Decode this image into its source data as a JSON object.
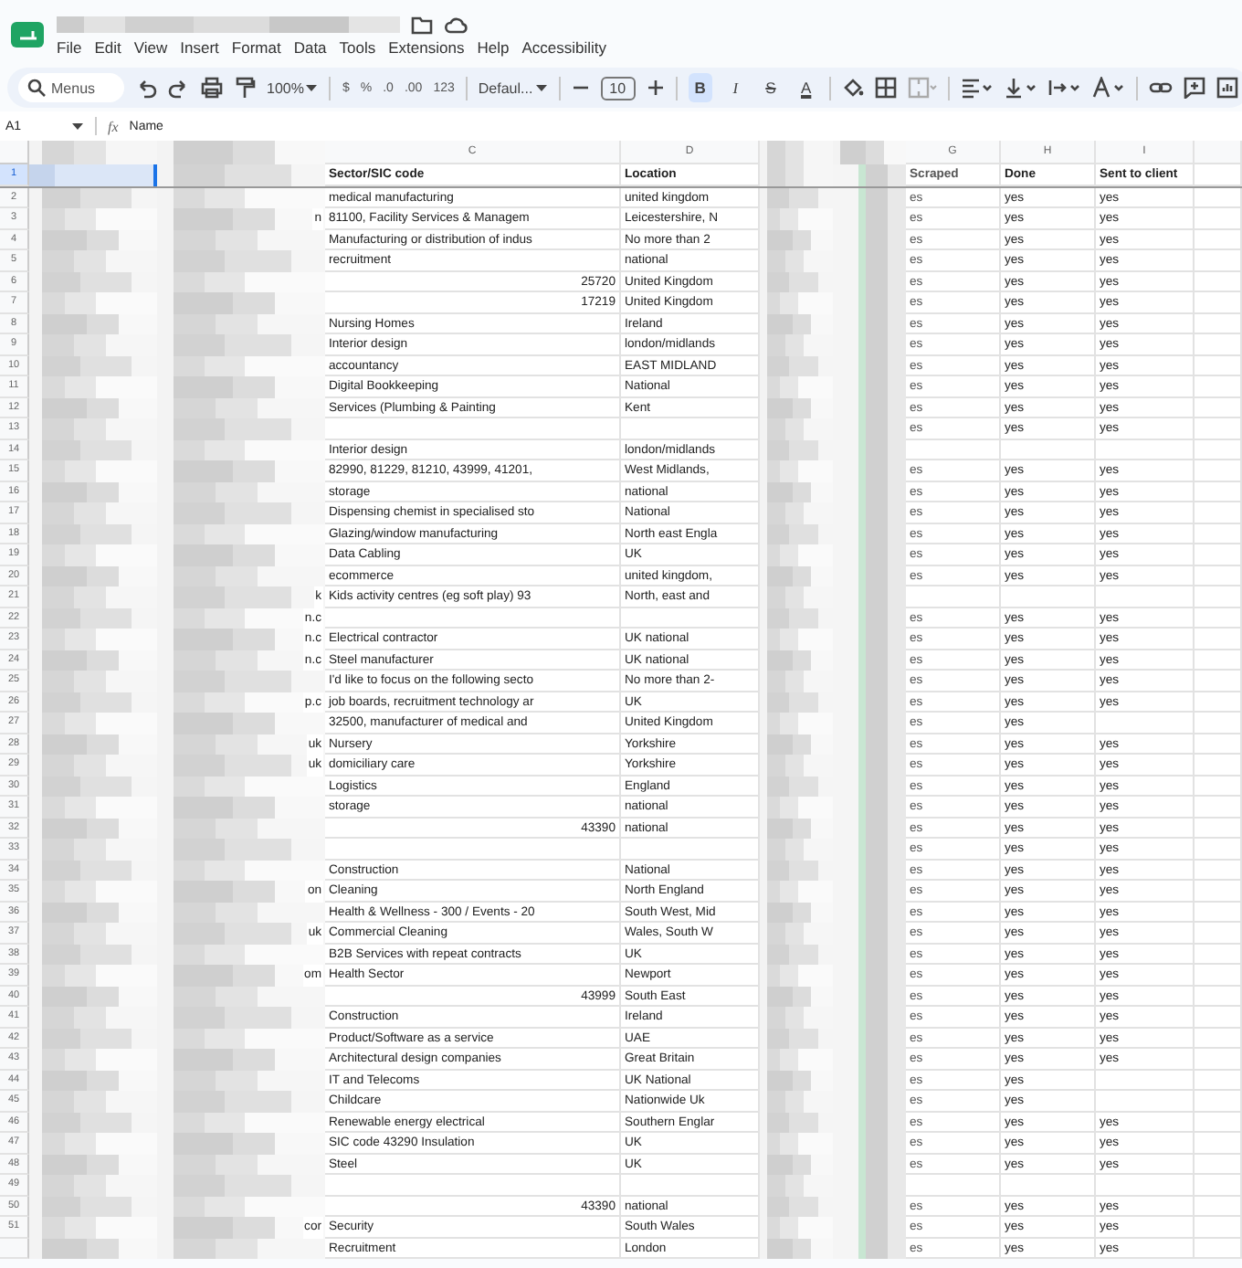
{
  "menu": [
    "File",
    "Edit",
    "View",
    "Insert",
    "Format",
    "Data",
    "Tools",
    "Extensions",
    "Help",
    "Accessibility"
  ],
  "toolbar": {
    "search_placeholder": "Menus",
    "zoom": "100%",
    "number_formats": [
      "$",
      "%",
      ".0",
      ".00",
      "123"
    ],
    "font": "Defaul...",
    "font_size": "10",
    "styles": [
      {
        "label": "B",
        "kind": "bold",
        "selected": true
      },
      {
        "label": "I",
        "kind": "italic",
        "selected": false
      },
      {
        "label": "S",
        "kind": "strike",
        "selected": false
      },
      {
        "label": "A",
        "kind": "color",
        "selected": false
      }
    ]
  },
  "formula_bar": {
    "cell_ref": "A1",
    "fx": "fx",
    "formula": "Name"
  },
  "columns": [
    {
      "kind": "blurred"
    },
    {
      "kind": "blurred"
    },
    {
      "kind": "label",
      "letter": "C"
    },
    {
      "kind": "label",
      "letter": "D"
    },
    {
      "kind": "blurred"
    },
    {
      "kind": "blurred"
    },
    {
      "kind": "label",
      "letter": "G"
    },
    {
      "kind": "label",
      "letter": "H"
    },
    {
      "kind": "label",
      "letter": "I"
    }
  ],
  "rows": [
    {
      "number": "1",
      "selected": true,
      "kind": "header",
      "c": {
        "text": "Sector/SIC code",
        "kind": "text"
      },
      "d": "Location",
      "g": "Scraped",
      "h": "Done",
      "i": "Sent to client"
    },
    {
      "number": "2",
      "selected": false,
      "kind": "data",
      "c": {
        "text": "medical manufacturing",
        "kind": "text"
      },
      "d": "united kingdom",
      "g": "es",
      "h": "yes",
      "i": "yes"
    },
    {
      "number": "3",
      "selected": false,
      "kind": "data",
      "b_tail": "n",
      "c": {
        "text": "81100, Facility Services & Managem",
        "kind": "text"
      },
      "d": "Leicestershire, N",
      "g": "es",
      "h": "yes",
      "i": "yes"
    },
    {
      "number": "4",
      "selected": false,
      "kind": "data",
      "c": {
        "text": "Manufacturing or distribution of indus",
        "kind": "text"
      },
      "d": "No more than 2",
      "g": "es",
      "h": "yes",
      "i": "yes"
    },
    {
      "number": "5",
      "selected": false,
      "kind": "data",
      "c": {
        "text": "recruitment",
        "kind": "text"
      },
      "d": "national",
      "g": "es",
      "h": "yes",
      "i": "yes"
    },
    {
      "number": "6",
      "selected": false,
      "kind": "data",
      "c": {
        "text": "25720",
        "kind": "number"
      },
      "d": "United Kingdom",
      "g": "es",
      "h": "yes",
      "i": "yes"
    },
    {
      "number": "7",
      "selected": false,
      "kind": "data",
      "c": {
        "text": "17219",
        "kind": "number"
      },
      "d": "United Kingdom",
      "g": "es",
      "h": "yes",
      "i": "yes"
    },
    {
      "number": "8",
      "selected": false,
      "kind": "data",
      "c": {
        "text": "Nursing Homes",
        "kind": "text"
      },
      "d": "Ireland",
      "g": "es",
      "h": "yes",
      "i": "yes"
    },
    {
      "number": "9",
      "selected": false,
      "kind": "data",
      "c": {
        "text": "Interior design",
        "kind": "text"
      },
      "d": "london/midlands",
      "g": "es",
      "h": "yes",
      "i": "yes"
    },
    {
      "number": "10",
      "selected": false,
      "kind": "data",
      "c": {
        "text": "accountancy",
        "kind": "text"
      },
      "d": "EAST MIDLAND",
      "g": "es",
      "h": "yes",
      "i": "yes"
    },
    {
      "number": "11",
      "selected": false,
      "kind": "data",
      "c": {
        "text": "Digital Bookkeeping",
        "kind": "text"
      },
      "d": "National",
      "g": "es",
      "h": "yes",
      "i": "yes"
    },
    {
      "number": "12",
      "selected": false,
      "kind": "data",
      "c": {
        "text": "Services (Plumbing & Painting",
        "kind": "text"
      },
      "d": "Kent",
      "g": "es",
      "h": "yes",
      "i": "yes"
    },
    {
      "number": "13",
      "selected": false,
      "kind": "data",
      "g": "es",
      "h": "yes",
      "i": "yes"
    },
    {
      "number": "14",
      "selected": false,
      "kind": "data",
      "c": {
        "text": "Interior design",
        "kind": "text"
      },
      "d": "london/midlands"
    },
    {
      "number": "15",
      "selected": false,
      "kind": "data",
      "c": {
        "text": "82990, 81229, 81210, 43999, 41201,",
        "kind": "text"
      },
      "d": "West Midlands,",
      "g": "es",
      "h": "yes",
      "i": "yes"
    },
    {
      "number": "16",
      "selected": false,
      "kind": "data",
      "c": {
        "text": "storage",
        "kind": "text"
      },
      "d": "national",
      "g": "es",
      "h": "yes",
      "i": "yes"
    },
    {
      "number": "17",
      "selected": false,
      "kind": "data",
      "c": {
        "text": "Dispensing chemist in specialised sto",
        "kind": "text"
      },
      "d": "National",
      "g": "es",
      "h": "yes",
      "i": "yes"
    },
    {
      "number": "18",
      "selected": false,
      "kind": "data",
      "c": {
        "text": "Glazing/window manufacturing",
        "kind": "text"
      },
      "d": "North east Engla",
      "g": "es",
      "h": "yes",
      "i": "yes"
    },
    {
      "number": "19",
      "selected": false,
      "kind": "data",
      "c": {
        "text": "Data Cabling",
        "kind": "text"
      },
      "d": "UK",
      "g": "es",
      "h": "yes",
      "i": "yes"
    },
    {
      "number": "20",
      "selected": false,
      "kind": "data",
      "c": {
        "text": "ecommerce",
        "kind": "text"
      },
      "d": "united kingdom,",
      "g": "es",
      "h": "yes",
      "i": "yes"
    },
    {
      "number": "21",
      "selected": false,
      "kind": "data",
      "b_tail": "k",
      "c": {
        "text": "Kids activity centres (eg soft play) 93",
        "kind": "text"
      },
      "d": "North, east and"
    },
    {
      "number": "22",
      "selected": false,
      "kind": "data",
      "b_tail": "n.c",
      "g": "es",
      "h": "yes",
      "i": "yes"
    },
    {
      "number": "23",
      "selected": false,
      "kind": "data",
      "b_tail": "n.c",
      "c": {
        "text": "Electrical contractor",
        "kind": "text"
      },
      "d": "UK national",
      "g": "es",
      "h": "yes",
      "i": "yes"
    },
    {
      "number": "24",
      "selected": false,
      "kind": "data",
      "b_tail": "n.c",
      "c": {
        "text": "Steel manufacturer",
        "kind": "text"
      },
      "d": "UK national",
      "g": "es",
      "h": "yes",
      "i": "yes"
    },
    {
      "number": "25",
      "selected": false,
      "kind": "data",
      "c": {
        "text": "I'd like to focus on the following secto",
        "kind": "text"
      },
      "d": "No more than 2-",
      "g": "es",
      "h": "yes",
      "i": "yes"
    },
    {
      "number": "26",
      "selected": false,
      "kind": "data",
      "b_tail": "p.c",
      "c": {
        "text": "job boards, recruitment technology ar",
        "kind": "text"
      },
      "d": "UK",
      "g": "es",
      "h": "yes",
      "i": "yes"
    },
    {
      "number": "27",
      "selected": false,
      "kind": "data",
      "c": {
        "text": "32500, manufacturer of medical and",
        "kind": "text"
      },
      "d": "United Kingdom",
      "g": "es",
      "h": "yes"
    },
    {
      "number": "28",
      "selected": false,
      "kind": "data",
      "b_tail": "uk",
      "c": {
        "text": "Nursery",
        "kind": "text"
      },
      "d": "Yorkshire",
      "g": "es",
      "h": "yes",
      "i": "yes"
    },
    {
      "number": "29",
      "selected": false,
      "kind": "data",
      "b_tail": "uk",
      "c": {
        "text": "domiciliary care",
        "kind": "text"
      },
      "d": "Yorkshire",
      "g": "es",
      "h": "yes",
      "i": "yes"
    },
    {
      "number": "30",
      "selected": false,
      "kind": "data",
      "c": {
        "text": "Logistics",
        "kind": "text"
      },
      "d": "England",
      "g": "es",
      "h": "yes",
      "i": "yes"
    },
    {
      "number": "31",
      "selected": false,
      "kind": "data",
      "c": {
        "text": "storage",
        "kind": "text"
      },
      "d": "national",
      "g": "es",
      "h": "yes",
      "i": "yes"
    },
    {
      "number": "32",
      "selected": false,
      "kind": "data",
      "c": {
        "text": "43390",
        "kind": "number"
      },
      "d": "national",
      "g": "es",
      "h": "yes",
      "i": "yes"
    },
    {
      "number": "33",
      "selected": false,
      "kind": "data",
      "g": "es",
      "h": "yes",
      "i": "yes"
    },
    {
      "number": "34",
      "selected": false,
      "kind": "data",
      "c": {
        "text": "Construction",
        "kind": "text"
      },
      "d": "National",
      "g": "es",
      "h": "yes",
      "i": "yes"
    },
    {
      "number": "35",
      "selected": false,
      "kind": "data",
      "b_tail": "on",
      "c": {
        "text": "Cleaning",
        "kind": "text"
      },
      "d": "North England",
      "g": "es",
      "h": "yes",
      "i": "yes"
    },
    {
      "number": "36",
      "selected": false,
      "kind": "data",
      "c": {
        "text": "Health & Wellness - 300 / Events - 20",
        "kind": "text"
      },
      "d": "South West, Mid",
      "g": "es",
      "h": "yes",
      "i": "yes"
    },
    {
      "number": "37",
      "selected": false,
      "kind": "data",
      "b_tail": "uk",
      "c": {
        "text": "Commercial Cleaning",
        "kind": "text"
      },
      "d": "Wales, South W",
      "g": "es",
      "h": "yes",
      "i": "yes"
    },
    {
      "number": "38",
      "selected": false,
      "kind": "data",
      "c": {
        "text": "B2B Services with repeat contracts",
        "kind": "text"
      },
      "d": "UK",
      "g": "es",
      "h": "yes",
      "i": "yes"
    },
    {
      "number": "39",
      "selected": false,
      "kind": "data",
      "b_tail": "om",
      "c": {
        "text": "Health Sector",
        "kind": "text"
      },
      "d": "Newport",
      "g": "es",
      "h": "yes",
      "i": "yes"
    },
    {
      "number": "40",
      "selected": false,
      "kind": "data",
      "c": {
        "text": "43999",
        "kind": "number"
      },
      "d": "South East",
      "g": "es",
      "h": "yes",
      "i": "yes"
    },
    {
      "number": "41",
      "selected": false,
      "kind": "data",
      "c": {
        "text": "Construction",
        "kind": "text"
      },
      "d": "Ireland",
      "g": "es",
      "h": "yes",
      "i": "yes"
    },
    {
      "number": "42",
      "selected": false,
      "kind": "data",
      "c": {
        "text": "Product/Software as a service",
        "kind": "text"
      },
      "d": "UAE",
      "g": "es",
      "h": "yes",
      "i": "yes"
    },
    {
      "number": "43",
      "selected": false,
      "kind": "data",
      "c": {
        "text": "Architectural design companies",
        "kind": "text"
      },
      "d": "Great Britain",
      "g": "es",
      "h": "yes",
      "i": "yes"
    },
    {
      "number": "44",
      "selected": false,
      "kind": "data",
      "c": {
        "text": "IT and Telecoms",
        "kind": "text"
      },
      "d": "UK National",
      "g": "es",
      "h": "yes"
    },
    {
      "number": "45",
      "selected": false,
      "kind": "data",
      "c": {
        "text": "Childcare",
        "kind": "text"
      },
      "d": "Nationwide Uk",
      "g": "es",
      "h": "yes"
    },
    {
      "number": "46",
      "selected": false,
      "kind": "data",
      "c": {
        "text": "Renewable energy electrical",
        "kind": "text"
      },
      "d": "Southern Englar",
      "g": "es",
      "h": "yes",
      "i": "yes"
    },
    {
      "number": "47",
      "selected": false,
      "kind": "data",
      "c": {
        "text": "SIC code 43290 Insulation",
        "kind": "text"
      },
      "d": "UK",
      "g": "es",
      "h": "yes",
      "i": "yes"
    },
    {
      "number": "48",
      "selected": false,
      "kind": "data",
      "c": {
        "text": "Steel",
        "kind": "text"
      },
      "d": "UK",
      "g": "es",
      "h": "yes",
      "i": "yes"
    },
    {
      "number": "49",
      "selected": false,
      "kind": "data"
    },
    {
      "number": "50",
      "selected": false,
      "kind": "data",
      "c": {
        "text": "43390",
        "kind": "number"
      },
      "d": "national",
      "g": "es",
      "h": "yes",
      "i": "yes"
    },
    {
      "number": "51",
      "selected": false,
      "kind": "data",
      "b_tail": "cor",
      "c": {
        "text": "Security",
        "kind": "text"
      },
      "d": "South Wales",
      "g": "es",
      "h": "yes",
      "i": "yes"
    },
    {
      "selected": false,
      "kind": "data",
      "c": {
        "text": "Recruitment",
        "kind": "text"
      },
      "d": "London",
      "g": "es",
      "h": "yes",
      "i": "yes"
    }
  ]
}
